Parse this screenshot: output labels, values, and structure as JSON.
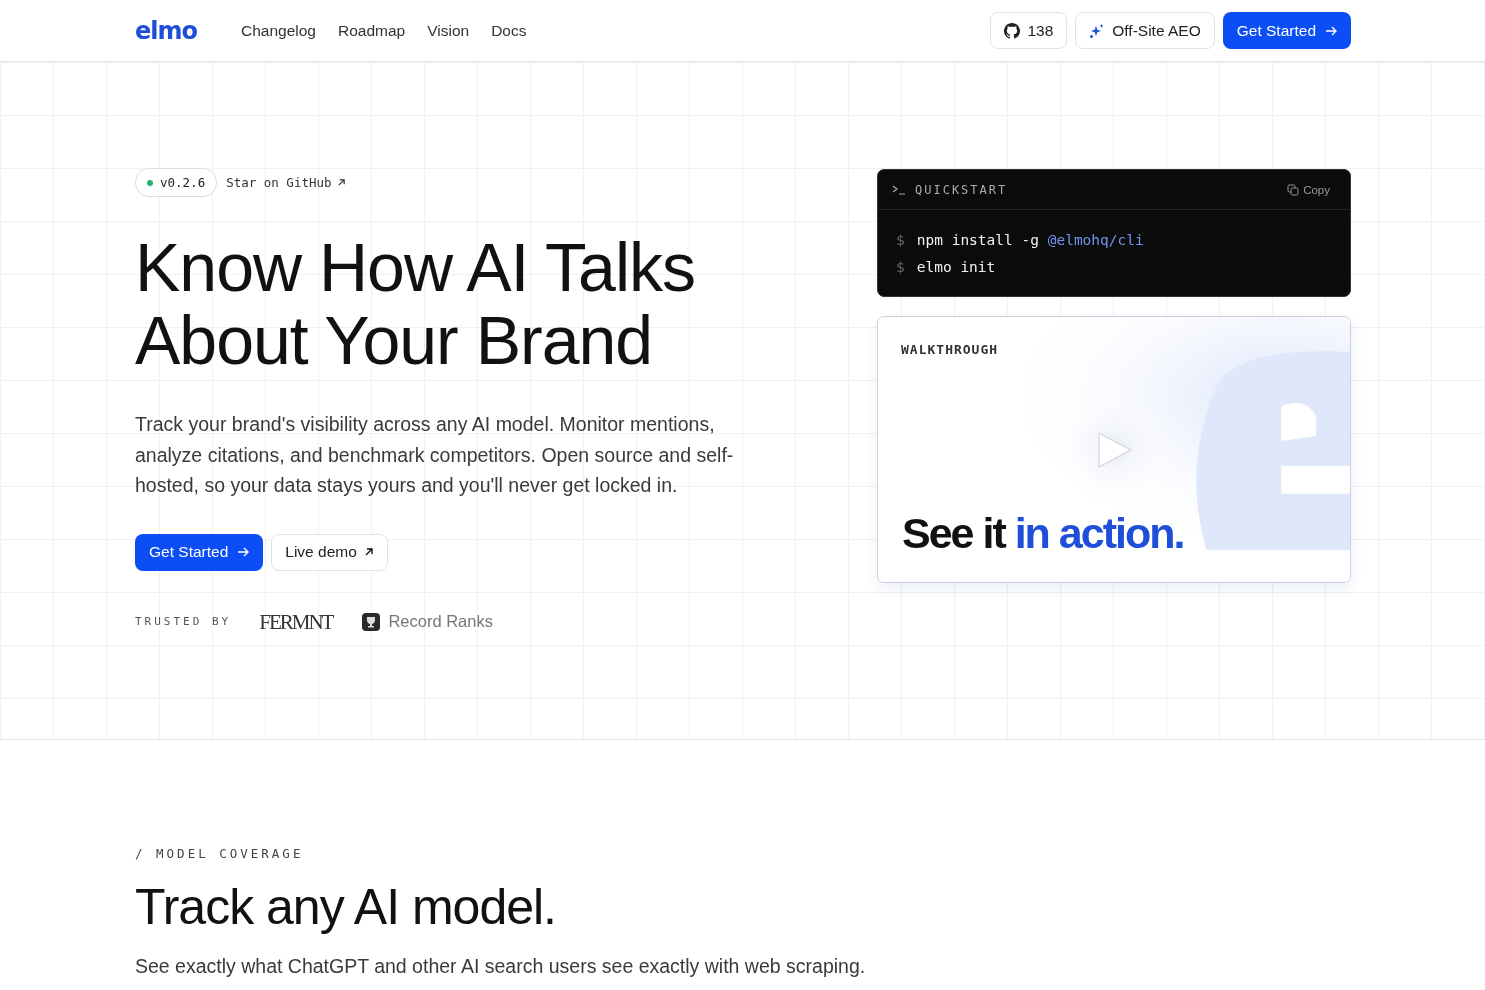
{
  "header": {
    "logo": "elmo",
    "nav": [
      "Changelog",
      "Roadmap",
      "Vision",
      "Docs"
    ],
    "github_count": "138",
    "aeo_button": "Off-Site AEO",
    "cta": "Get Started"
  },
  "hero": {
    "version": "v0.2.6",
    "star_link": "Star on GitHub",
    "title_lines": [
      "Know How AI Talks",
      "About Your Brand"
    ],
    "description": "Track your brand's visibility across any AI model. Monitor mentions, analyze citations, and benchmark competitors. Open source and self-hosted, so your data stays yours and you'll never get locked in.",
    "primary_button": "Get Started",
    "secondary_button": "Live demo",
    "trusted_label": "TRUSTED BY",
    "logos": [
      {
        "kind": "wordmark",
        "text": "FERMNT"
      },
      {
        "kind": "icon-wordmark",
        "text": "Record Ranks"
      }
    ]
  },
  "quickstart": {
    "title": "QUICKSTART",
    "copy": "Copy",
    "lines": [
      {
        "prompt": "$",
        "command": "npm install -g ",
        "argument": "@elmohq/cli"
      },
      {
        "prompt": "$",
        "command": "elmo init"
      }
    ]
  },
  "walkthrough": {
    "label": "WALKTHROUGH",
    "headline": "See it",
    "headline_accent": "in action."
  },
  "model_coverage": {
    "eyebrow": "/ MODEL COVERAGE",
    "title": "Track any AI model.",
    "description": "See exactly what ChatGPT and other AI search users see exactly with web scraping."
  }
}
